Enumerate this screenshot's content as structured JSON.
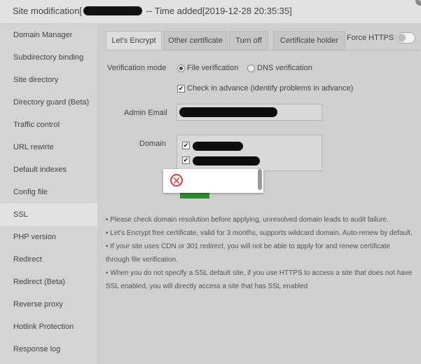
{
  "window": {
    "title_prefix": "Site modification[",
    "title_suffix": " -- Time added[2019-12-28 20:35:35]",
    "close_glyph": "×"
  },
  "sidebar": {
    "items": [
      {
        "label": "Domain Manager"
      },
      {
        "label": "Subdirectory binding"
      },
      {
        "label": "Site directory"
      },
      {
        "label": "Directory guard (Beta)"
      },
      {
        "label": "Traffic control"
      },
      {
        "label": "URL rewirte"
      },
      {
        "label": "Default indexes"
      },
      {
        "label": "Config file"
      },
      {
        "label": "SSL",
        "active": true
      },
      {
        "label": "PHP version"
      },
      {
        "label": "Redirect"
      },
      {
        "label": "Redirect (Beta)"
      },
      {
        "label": "Reverse proxy"
      },
      {
        "label": "Hotlink Protection"
      },
      {
        "label": "Response log"
      }
    ]
  },
  "tabs": [
    {
      "label": "Let's Encrypt",
      "active": true
    },
    {
      "label": "Other certificate"
    },
    {
      "label": "Turn off"
    },
    {
      "label": "Certificate holder"
    }
  ],
  "force_https": {
    "label": "Force HTTPS",
    "enabled": false
  },
  "form": {
    "verification_label": "Verification mode",
    "option_file": "File verification",
    "option_dns": "DNS verification",
    "check_advance": "Check in advance (identify problems in advance)",
    "admin_email_label": "Admin Email",
    "domain_label": "Domain"
  },
  "popup": {
    "icon": "error-icon",
    "glyph": "✕"
  },
  "notes": [
    "•  Please check domain resolution before applying, unresolved domain leads to audit failure.",
    "•  Let's Encrypt free certificate, valid for 3 months, supports wildcard domain. Auto-renew by default.",
    "•  If your site uses CDN or 301 redirect, you will not be able to apply for and renew certificate through file verification.",
    "•  When you do not specify a SSL default site, if you use HTTPS to access a site that does not have SSL enabled, you will directly access a site that has SSL enabled"
  ],
  "colors": {
    "apply_button": "#2f8a2f",
    "error": "#e53935"
  }
}
